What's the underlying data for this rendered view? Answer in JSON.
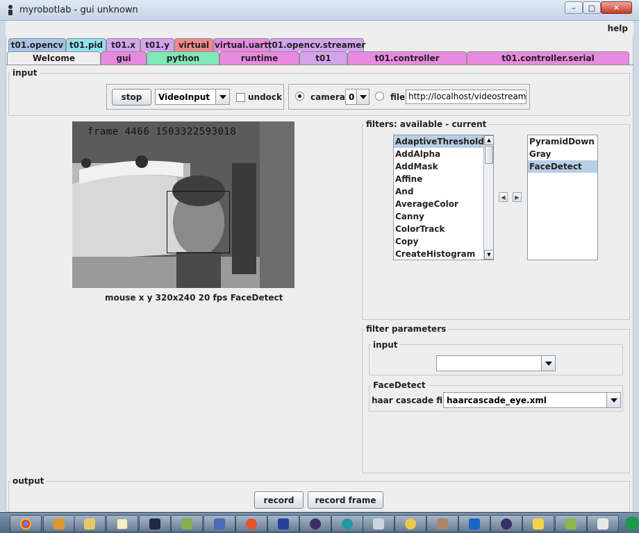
{
  "window": {
    "title": "myrobotlab - gui unknown",
    "min": "–",
    "max": "□",
    "close": "✕"
  },
  "menu": {
    "help": "help"
  },
  "tabs_row1": [
    "t01.opencv",
    "t01.pid",
    "t01.x",
    "t01.y",
    "virtual",
    "virtual.uart",
    "t01.opencv.streamer"
  ],
  "tabs_row2": [
    "Welcome",
    "gui",
    "python",
    "runtime",
    "t01",
    "t01.controller",
    "t01.controller.serial"
  ],
  "input": {
    "legend": "input",
    "stop": "stop",
    "source": "VideoInput",
    "undock": "undock",
    "camera": "camera",
    "camera_index": "0",
    "file": "file",
    "file_url": "http://localhost/videostream.cgi"
  },
  "video": {
    "overlay": "frame 4466 1503322593018",
    "status": "mouse x y  320x240  20 fps  FaceDetect"
  },
  "filters": {
    "legend": "filters: available - current",
    "available": [
      "AdaptiveThreshold",
      "AddAlpha",
      "AddMask",
      "Affine",
      "And",
      "AverageColor",
      "Canny",
      "ColorTrack",
      "Copy",
      "CreateHistogram"
    ],
    "current": [
      "PyramidDown",
      "Gray",
      "FaceDetect"
    ],
    "move_left": "◀",
    "move_right": "▶"
  },
  "filter_parameters": {
    "legend": "filter parameters",
    "input_legend": "input",
    "input_value": "",
    "facedetect_legend": "FaceDetect",
    "haar_label": "haar cascade file",
    "haar_value": "haarcascade_eye.xml"
  },
  "output": {
    "legend": "output",
    "record": "record",
    "record_frame": "record frame"
  },
  "colors": {
    "tab_welcome": "#eeeeee",
    "tab_pink": "#e88ae0",
    "tab_green": "#80e8b8",
    "tab_violet": "#d4a3ec",
    "tab_blue": "#a7c4e8",
    "tab_cyan": "#8fe3f0",
    "tab_red": "#f08a8a"
  }
}
